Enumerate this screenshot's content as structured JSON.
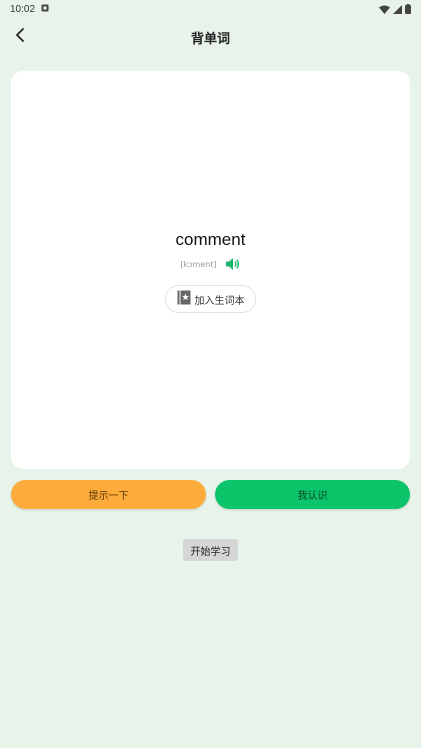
{
  "status_bar": {
    "time": "10:02"
  },
  "header": {
    "title": "背单词"
  },
  "card": {
    "word": "comment",
    "phonetic": "[kɔment]",
    "add_button_label": "加入生词本"
  },
  "actions": {
    "hint_label": "提示一下",
    "know_label": "我认识",
    "start_label": "开始学习"
  },
  "colors": {
    "background": "#e8f3ea",
    "hint_button": "#fdac3b",
    "know_button": "#0cc46a",
    "speaker": "#1fb56a"
  }
}
